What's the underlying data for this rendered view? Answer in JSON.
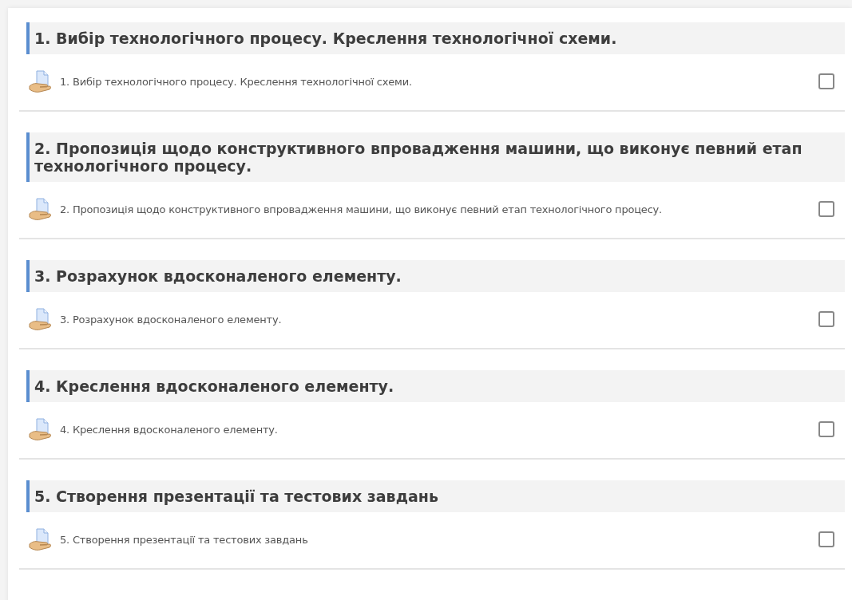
{
  "sections": [
    {
      "title": "1. Вибір технологічного процесу. Креслення технологічної схеми.",
      "activity": {
        "name": "1. Вибір технологічного процесу. Креслення технологічної схеми.",
        "checked": false
      }
    },
    {
      "title": "2. Пропозиція щодо конструктивного впровадження машини, що виконує певний етап технологічного процесу.",
      "activity": {
        "name": "2. Пропозиція щодо конструктивного впровадження машини, що виконує певний етап технологічного процесу.",
        "checked": false
      }
    },
    {
      "title": "3. Розрахунок вдосконаленого елементу.",
      "activity": {
        "name": "3. Розрахунок вдосконаленого елементу.",
        "checked": false
      }
    },
    {
      "title": "4. Креслення вдосконаленого елементу.",
      "activity": {
        "name": "4. Креслення вдосконаленого елементу.",
        "checked": false
      }
    },
    {
      "title": "5. Створення презентації та тестових завдань",
      "activity": {
        "name": "5. Створення презентації та тестових завдань",
        "checked": false
      }
    }
  ]
}
